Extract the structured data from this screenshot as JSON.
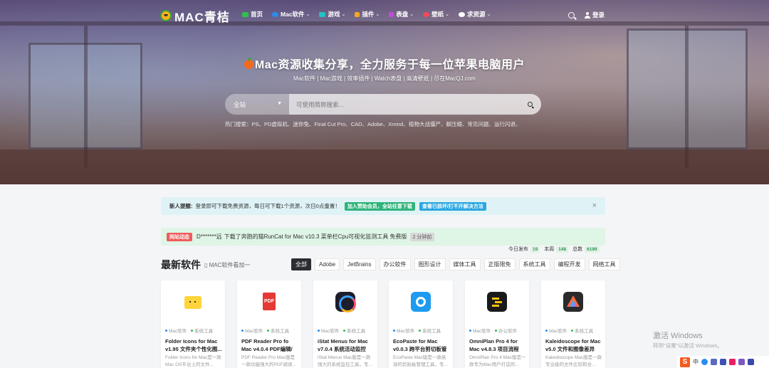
{
  "nav": {
    "logo_text": "MAC青桔",
    "menu": [
      {
        "label": "首页",
        "color": "#2fbf4f",
        "has_caret": false
      },
      {
        "label": "Mac软件",
        "color": "#2a8cf0",
        "has_caret": true
      },
      {
        "label": "游戏",
        "color": "#22c1c3",
        "has_caret": true
      },
      {
        "label": "插件",
        "color": "#f5a623",
        "has_caret": true
      },
      {
        "label": "表盘",
        "color": "#c04bd8",
        "has_caret": true
      },
      {
        "label": "壁纸",
        "color": "#f04a5a",
        "has_caret": true
      },
      {
        "label": "求资源",
        "color": "#ffffff",
        "has_caret": true
      }
    ],
    "login_label": "登录"
  },
  "hero": {
    "title": "Mac资源收集分享，全力服务于每一位苹果电脑用户",
    "subtitle": "Mac软件 | Mac游戏 | 效率插件 | Watch表盘 | 高清壁纸 | 尽在MacQJ.com",
    "search_scope": "全站",
    "search_placeholder": "可使用简称搜索...",
    "hot_searches": "热门搜索：PS、PD虚拟机、迷你兔、Final Cut Pro、CAD、Adobe、Xmind、植物大战僵尸、解压缩、常见问题、运行闪退、"
  },
  "notice": {
    "label": "新人提醒:",
    "text": "登录即可下载免费资源，每日可下载1个资源，次日0点重置！",
    "btn_join": "加入赞助会员，全站任意下载",
    "btn_fix": "查看已损坏/打不开解决方法",
    "close": "×"
  },
  "activity": {
    "badge": "网站动态",
    "user": "D*******远",
    "text": "下载了奔跑的猫RunCat for Mac v10.3 菜单栏Cpu可视化监测工具 免费版",
    "time": "2 分钟前"
  },
  "stats": {
    "today_label": "今日发布",
    "today": "19",
    "week_label": "本周",
    "week": "148",
    "total_label": "总数",
    "total": "6199"
  },
  "section": {
    "title": "最新软件",
    "subtitle": "MAC软件看加一",
    "tabs": [
      "全部",
      "Adobe",
      "JetBrains",
      "办公软件",
      "图形设计",
      "媒体工具",
      "正版限免",
      "系统工具",
      "编程开发",
      "网络工具"
    ]
  },
  "cards": [
    {
      "cat1": "Mac软件",
      "cat2": "系统工具",
      "title": "Folder Icons for Mac v1.95 文件夹个性化图...",
      "desc": "Folder Icons for Mac是一款Mac OS平台上的文件...",
      "icon": "folder-icon"
    },
    {
      "cat1": "Mac软件",
      "cat2": "系统工具",
      "title": "PDF Reader Pro fo Mac v4.0.4 PDF编辑/批...",
      "desc": "PDF Reader Pro Mac版是一款功能强大的PDF阅读...",
      "icon": "pdf-icon"
    },
    {
      "cat1": "Mac软件",
      "cat2": "系统工具",
      "title": "iStat Menus for Mac v7.0.4 系统活动监控菜...",
      "desc": "iStat Menus Mac版是一款强大的系统监控工具，专...",
      "icon": "istat-icon"
    },
    {
      "cat1": "Mac软件",
      "cat2": "系统工具",
      "title": "EcoPaste for Mac v0.0.3 跨平台剪切板管理工具",
      "desc": "EcoPaste Mac版是一款高效的剪贴板管理工具，专...",
      "icon": "ecopaste-icon"
    },
    {
      "cat1": "Mac软件",
      "cat2": "办公软件",
      "title": "OmniPlan Pro 4 for Mac v4.8.3 项目流程管...",
      "desc": "OmniPlan Pro 4 Mac版是一款专为Mac用户打造的...",
      "icon": "omniplan-icon"
    },
    {
      "cat1": "Mac软件",
      "cat2": "系统工具",
      "title": "Kaleidoscope for Mac v5.0 文件和图像差异对...",
      "desc": "Kaleidoscope Mac版是一款专业级的文件比较和合...",
      "icon": "kaleidoscope-icon"
    }
  ],
  "watermark": {
    "title": "激活 Windows",
    "subtitle": "转到\"设置\"以激活 Windows。"
  },
  "tray": {
    "ime": "S",
    "lang": "中"
  }
}
